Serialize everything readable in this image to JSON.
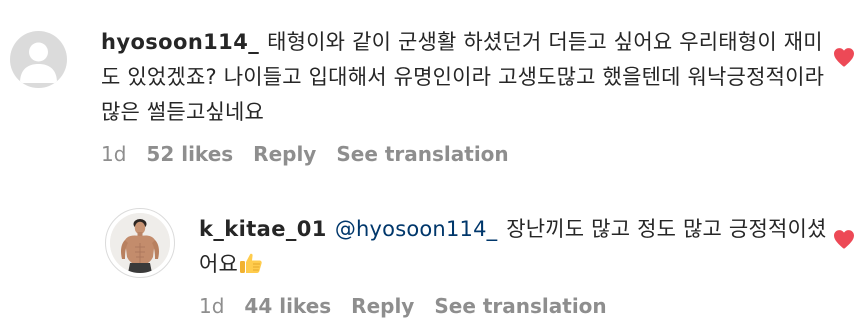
{
  "comments": [
    {
      "username": "hyosoon114_",
      "text": "태형이와 같이 군생활 하셨던거 더듣고 싶어요 우리태형이 재미도 있었겠죠? 나이들고 입대해서 유명인이라 고생도많고 했을텐데 워낙긍정적이라 많은 썰듣고싶네요",
      "time": "1d",
      "likes": "52 likes",
      "reply_label": "Reply",
      "translate_label": "See translation",
      "liked": true,
      "avatar": "default-avatar-icon"
    },
    {
      "username": "k_kitae_01",
      "mention": "@hyosoon114_",
      "text": "장난끼도 많고 정도 많고 긍정적이셨어요",
      "emoji": "thumbs-up-icon",
      "time": "1d",
      "likes": "44 likes",
      "reply_label": "Reply",
      "translate_label": "See translation",
      "liked": true,
      "avatar": "profile-photo"
    }
  ],
  "colors": {
    "text": "#262626",
    "meta": "#8e8e8e",
    "mention": "#00376b",
    "heart": "#ed4956",
    "avatar_bg": "#dbdbdb"
  }
}
